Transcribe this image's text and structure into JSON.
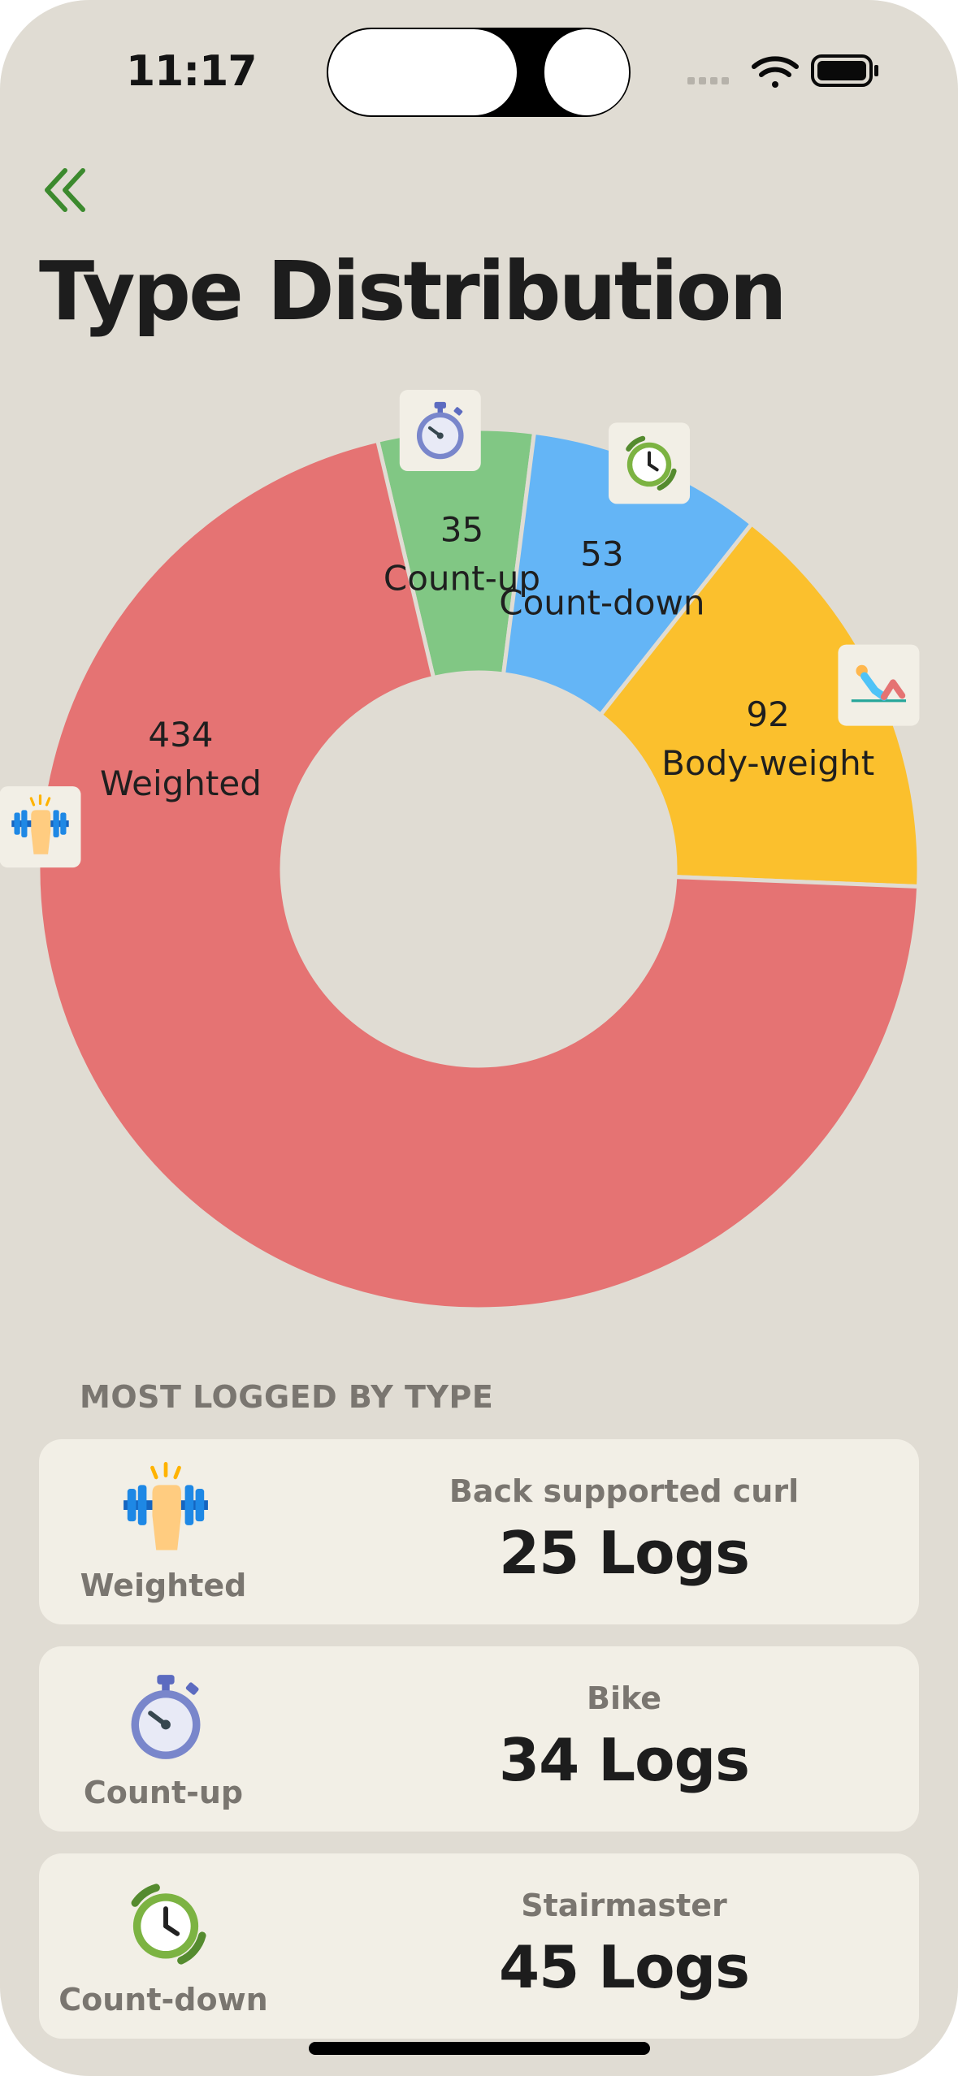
{
  "status_bar": {
    "time": "11:17"
  },
  "page": {
    "title": "Type Distribution"
  },
  "chart_data": {
    "type": "pie",
    "style": "donut",
    "slices": [
      {
        "label": "Count-up",
        "value": 35,
        "color": "#81c784",
        "icon": "stopwatch-icon"
      },
      {
        "label": "Count-down",
        "value": 53,
        "color": "#64b5f6",
        "icon": "timer-icon"
      },
      {
        "label": "Body-weight",
        "value": 92,
        "color": "#fbc02d",
        "icon": "situp-icon"
      },
      {
        "label": "Weighted",
        "value": 434,
        "color": "#e57373",
        "icon": "dumbbell-icon"
      }
    ],
    "legend": false
  },
  "most_logged": {
    "header": "MOST LOGGED BY TYPE",
    "items": [
      {
        "type": "Weighted",
        "exercise": "Back supported curl",
        "logs": "25 Logs",
        "icon": "dumbbell-icon"
      },
      {
        "type": "Count-up",
        "exercise": "Bike",
        "logs": "34 Logs",
        "icon": "stopwatch-icon"
      },
      {
        "type": "Count-down",
        "exercise": "Stairmaster",
        "logs": "45 Logs",
        "icon": "timer-icon"
      }
    ]
  }
}
